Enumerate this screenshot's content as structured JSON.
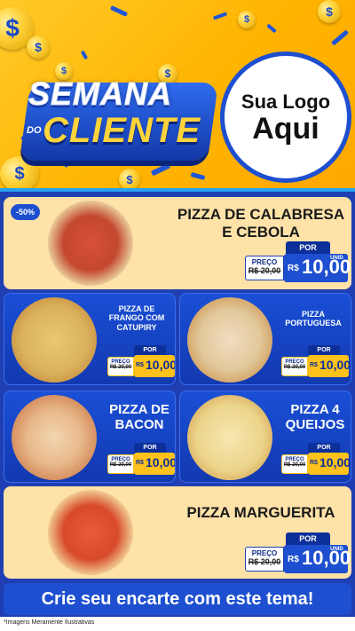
{
  "header": {
    "title_line1": "SEMANA",
    "title_small": "DO",
    "title_line2": "CLIENTE",
    "logo_line1": "Sua Logo",
    "logo_line2": "Aqui",
    "coin_symbol": "$"
  },
  "products": [
    {
      "name_line1": "PIZZA DE CALABRESA",
      "name_line2": "E CEBOLA",
      "badge": "-50%",
      "por": "POR",
      "preco": "PREÇO",
      "old_price": "R$ 20,00",
      "currency": "R$",
      "price": "10,00",
      "unit": "UNID"
    },
    {
      "name_line1": "PIZZA DE",
      "name_line2": "FRANGO COM",
      "name_line3": "CATUPIRY",
      "por": "POR",
      "preco": "PREÇO",
      "old_price": "R$ 20,00",
      "currency": "R$",
      "price": "10,00",
      "unit": "UNID"
    },
    {
      "name_line1": "PIZZA",
      "name_line2": "PORTUGUESA",
      "por": "POR",
      "preco": "PREÇO",
      "old_price": "R$ 20,00",
      "currency": "R$",
      "price": "10,00",
      "unit": "UNID"
    },
    {
      "name_line1": "PIZZA DE",
      "name_line2": "BACON",
      "por": "POR",
      "preco": "PREÇO",
      "old_price": "R$ 20,00",
      "currency": "R$",
      "price": "10,00",
      "unit": "UNID"
    },
    {
      "name_line1": "PIZZA 4",
      "name_line2": "QUEIJOS",
      "por": "POR",
      "preco": "PREÇO",
      "old_price": "R$ 20,00",
      "currency": "R$",
      "price": "10,00",
      "unit": "UNID"
    },
    {
      "name_line1": "PIZZA MARGUERITA",
      "por": "POR",
      "preco": "PREÇO",
      "old_price": "R$ 20,00",
      "currency": "R$",
      "price": "10,00",
      "unit": "UNID"
    }
  ],
  "cta": "Crie seu encarte com este tema!",
  "footnote": "*Imagens Meramente Ilustrativas",
  "colors": {
    "brand_blue": "#1d4fd0",
    "yellow": "#ffc21a",
    "cream": "#ffe2a8"
  }
}
